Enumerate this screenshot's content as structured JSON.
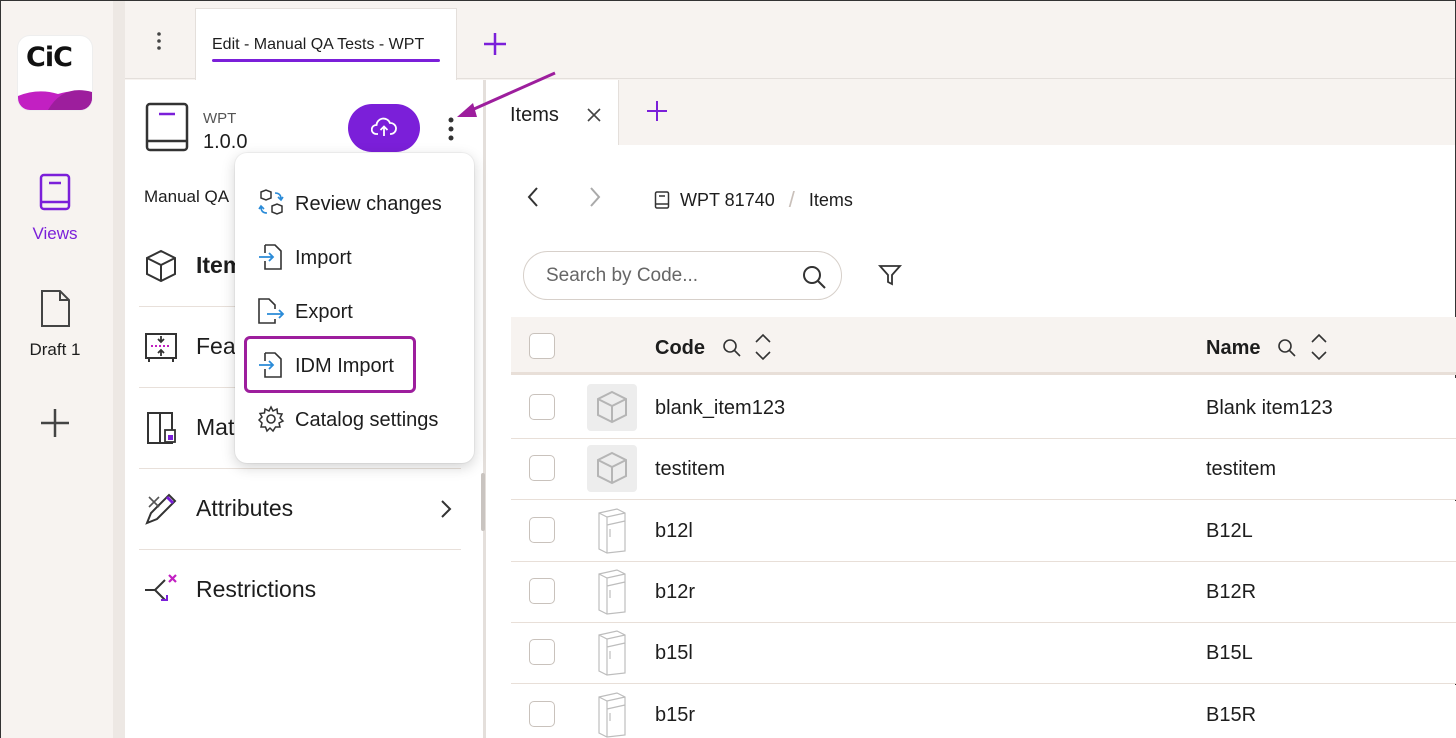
{
  "rail": {
    "logo_text": "CiC",
    "views_label": "Views",
    "draft_label": "Draft 1"
  },
  "top_tabs": {
    "active_label": "Edit - Manual QA Tests - WPT"
  },
  "panel": {
    "catalog_code": "WPT",
    "catalog_version": "1.0.0",
    "catalog_title": "Manual QA",
    "nav": [
      {
        "label": "Items",
        "icon": "cube-icon"
      },
      {
        "label": "Features",
        "icon": "features-icon"
      },
      {
        "label": "Materials",
        "icon": "materials-icon"
      },
      {
        "label": "Attributes",
        "icon": "attributes-icon"
      },
      {
        "label": "Restrictions",
        "icon": "restrictions-icon"
      }
    ]
  },
  "menu": {
    "items": [
      {
        "label": "Review changes",
        "icon": "review-changes-icon"
      },
      {
        "label": "Import",
        "icon": "import-icon"
      },
      {
        "label": "Export",
        "icon": "export-icon"
      },
      {
        "label": "IDM Import",
        "icon": "idm-import-icon"
      },
      {
        "label": "Catalog settings",
        "icon": "gear-icon"
      }
    ]
  },
  "main": {
    "subtab_label": "Items",
    "breadcrumb": [
      "WPT 81740",
      "Items"
    ],
    "search_placeholder": "Search by Code...",
    "columns": [
      "Code",
      "Name"
    ],
    "rows": [
      {
        "code": "blank_item123",
        "name": "Blank item123",
        "thumb": "box"
      },
      {
        "code": "testitem",
        "name": "testitem",
        "thumb": "box"
      },
      {
        "code": "b12l",
        "name": "B12L",
        "thumb": "cabinet"
      },
      {
        "code": "b12r",
        "name": "B12R",
        "thumb": "cabinet"
      },
      {
        "code": "b15l",
        "name": "B15L",
        "thumb": "cabinet"
      },
      {
        "code": "b15r",
        "name": "B15R",
        "thumb": "cabinet"
      }
    ]
  },
  "colors": {
    "accent": "#7b1fd9",
    "highlight": "#9d1e9d",
    "background": "#f7f3f0"
  }
}
